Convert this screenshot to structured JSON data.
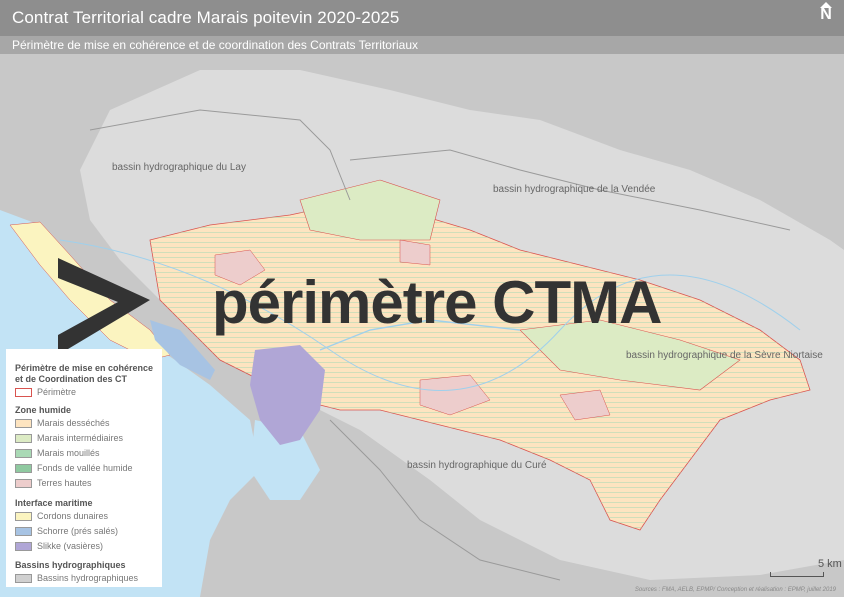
{
  "header": {
    "title": "Contrat Territorial  cadre Marais poitevin 2020-2025",
    "subtitle": "Périmètre de mise en cohérence et de coordination des Contrats Territoriaux",
    "north_symbol": "N"
  },
  "map": {
    "basins": [
      {
        "label": "bassin hydrographique du Lay"
      },
      {
        "label": "bassin hydrographique de la Vendée"
      },
      {
        "label": "bassin hydrographique de la Sèvre Niortaise"
      },
      {
        "label": "bassin hydrographique du Curé"
      }
    ],
    "highlight_label": "périmètre CTMA",
    "colors": {
      "land": "#c8c8c8",
      "basin_area": "#dcdcdc",
      "sea": "#c2e3f5",
      "marais_desseches": "#fde4c0",
      "marais_intermediaires": "#dcebc4",
      "marais_mouilles": "#a9d9b5",
      "terres_hautes": "#edcdcc",
      "cordons_dunaires": "#fbf4c0",
      "schorre": "#a7c3e3",
      "slikke": "#b0a6d6",
      "perimetre": "#d9534f",
      "arrow": "#333333"
    }
  },
  "legend": {
    "title": "Périmètre de mise en cohérence et de Coordination des CT",
    "perimetre": {
      "label": "Périmètre"
    },
    "zone_humide": {
      "title": "Zone humide",
      "items": [
        {
          "label": "Marais desséchés",
          "color": "#fde4c0"
        },
        {
          "label": "Marais intermédiaires",
          "color": "#dcebc4"
        },
        {
          "label": "Marais mouillés",
          "color": "#a9d9b5"
        },
        {
          "label": "Fonds de vallée humide",
          "color": "#8fc9a0"
        },
        {
          "label": "Terres hautes",
          "color": "#edcdcc"
        }
      ]
    },
    "interface_maritime": {
      "title": "Interface maritime",
      "items": [
        {
          "label": "Cordons dunaires",
          "color": "#fbf4c0"
        },
        {
          "label": "Schorre (prés salés)",
          "color": "#a7c3e3"
        },
        {
          "label": "Slikke (vasières)",
          "color": "#b0a6d6"
        }
      ]
    },
    "bassins": {
      "title": "Bassins hydrographiques",
      "items": [
        {
          "label": "Bassins hydrographiques",
          "color": "#d0d0d0"
        }
      ]
    }
  },
  "scale_label": "5 km",
  "sources": "Sources : FMA, AELB, EPMP/ Conception et réalisation : EPMP, juillet 2019"
}
